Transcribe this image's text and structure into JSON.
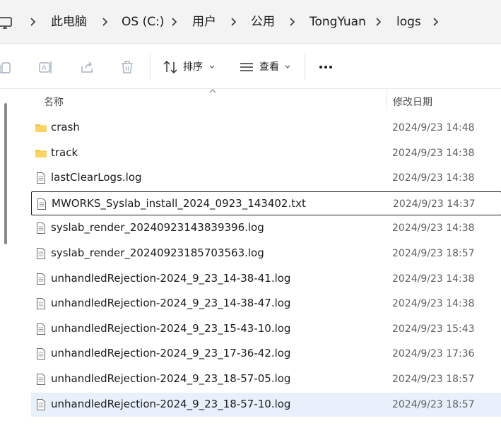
{
  "breadcrumb": {
    "items": [
      {
        "label": "此电脑"
      },
      {
        "label": "OS (C:)"
      },
      {
        "label": "用户"
      },
      {
        "label": "公用"
      },
      {
        "label": "TongYuan"
      },
      {
        "label": "logs"
      }
    ]
  },
  "toolbar": {
    "sort_label": "排序",
    "view_label": "查看",
    "icons": [
      "copy-icon",
      "rename-icon",
      "share-icon",
      "delete-icon",
      "sort-icon",
      "view-icon",
      "more-icon"
    ]
  },
  "columns": {
    "name": "名称",
    "date_modified": "修改日期"
  },
  "files": [
    {
      "name": "crash",
      "date": "2024/9/23 14:48",
      "type": "folder"
    },
    {
      "name": "track",
      "date": "2024/9/23 14:38",
      "type": "folder"
    },
    {
      "name": "lastClearLogs.log",
      "date": "2024/9/23 14:38",
      "type": "file"
    },
    {
      "name": "MWORKS_Syslab_install_2024_0923_143402.txt",
      "date": "2024/9/23 14:37",
      "type": "file",
      "state": "selected"
    },
    {
      "name": "syslab_render_20240923143839396.log",
      "date": "2024/9/23 14:38",
      "type": "file"
    },
    {
      "name": "syslab_render_20240923185703563.log",
      "date": "2024/9/23 18:57",
      "type": "file"
    },
    {
      "name": "unhandledRejection-2024_9_23_14-38-41.log",
      "date": "2024/9/23 14:38",
      "type": "file"
    },
    {
      "name": "unhandledRejection-2024_9_23_14-38-47.log",
      "date": "2024/9/23 14:38",
      "type": "file"
    },
    {
      "name": "unhandledRejection-2024_9_23_15-43-10.log",
      "date": "2024/9/23 15:43",
      "type": "file"
    },
    {
      "name": "unhandledRejection-2024_9_23_17-36-42.log",
      "date": "2024/9/23 17:36",
      "type": "file"
    },
    {
      "name": "unhandledRejection-2024_9_23_18-57-05.log",
      "date": "2024/9/23 18:57",
      "type": "file"
    },
    {
      "name": "unhandledRejection-2024_9_23_18-57-10.log",
      "date": "2024/9/23 18:57",
      "type": "file",
      "state": "hovered"
    }
  ],
  "colors": {
    "folder": "#f5c33b",
    "selection_border": "#1f1f1f",
    "hover_bg": "#e8f1fb"
  }
}
